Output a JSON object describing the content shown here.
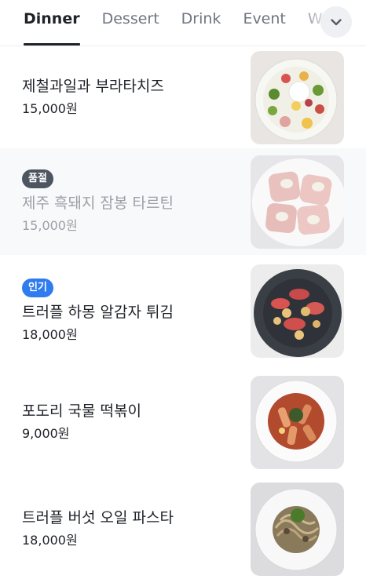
{
  "tabs": [
    {
      "label": "Dinner",
      "active": true
    },
    {
      "label": "Dessert",
      "active": false
    },
    {
      "label": "Drink",
      "active": false
    },
    {
      "label": "Event",
      "active": false
    },
    {
      "label": "W",
      "active": false
    }
  ],
  "more_button_icon": "chevron-down-icon",
  "menu_items": [
    {
      "name": "제철과일과 부라타치즈",
      "price": "15,000원",
      "badge": null,
      "image": "burrata-salad"
    },
    {
      "name": "제주 흑돼지 잠봉 타르틴",
      "price": "15,000원",
      "badge": "품절",
      "image": "jambon-tartine"
    },
    {
      "name": "트러플 하몽 알감자 튀김",
      "price": "18,000원",
      "badge": "인기",
      "image": "jamon-potato"
    },
    {
      "name": "포도리 국물 떡볶이",
      "price": "9,000원",
      "badge": null,
      "image": "tteokbokki"
    },
    {
      "name": "트러플 버섯 오일 파스타",
      "price": "18,000원",
      "badge": null,
      "image": "truffle-pasta"
    }
  ],
  "colors": {
    "text": "#1f2228",
    "muted": "#9aa0a8",
    "soldout_badge": "#4d5560",
    "popular_badge": "#2f7bf0"
  }
}
